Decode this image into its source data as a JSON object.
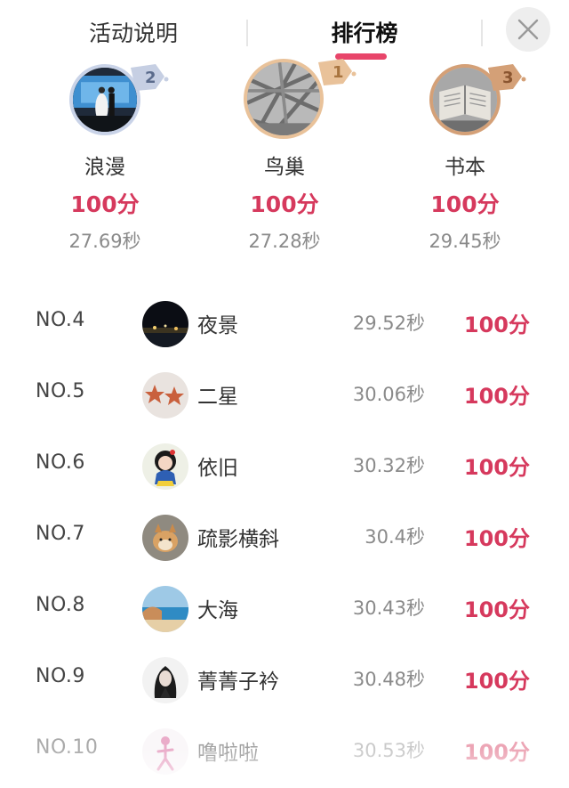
{
  "tabs": {
    "activity_info": "活动说明",
    "ranking": "排行榜",
    "active": "ranking"
  },
  "close_icon": "close-icon",
  "accent_color": "#d6395d",
  "podium": [
    {
      "rank": "2",
      "name": "浪漫",
      "score": "100分",
      "time": "27.69秒"
    },
    {
      "rank": "1",
      "name": "鸟巢",
      "score": "100分",
      "time": "27.28秒"
    },
    {
      "rank": "3",
      "name": "书本",
      "score": "100分",
      "time": "29.45秒"
    }
  ],
  "list": [
    {
      "no": "NO.4",
      "name": "夜景",
      "time": "29.52秒",
      "score": "100分"
    },
    {
      "no": "NO.5",
      "name": "二星",
      "time": "30.06秒",
      "score": "100分"
    },
    {
      "no": "NO.6",
      "name": "依旧",
      "time": "30.32秒",
      "score": "100分"
    },
    {
      "no": "NO.7",
      "name": "疏影横斜",
      "time": "30.4秒",
      "score": "100分"
    },
    {
      "no": "NO.8",
      "name": "大海",
      "time": "30.43秒",
      "score": "100分"
    },
    {
      "no": "NO.9",
      "name": "菁菁子衿",
      "time": "30.48秒",
      "score": "100分"
    },
    {
      "no": "NO.10",
      "name": "噜啦啦",
      "time": "30.53秒",
      "score": "100分"
    }
  ]
}
